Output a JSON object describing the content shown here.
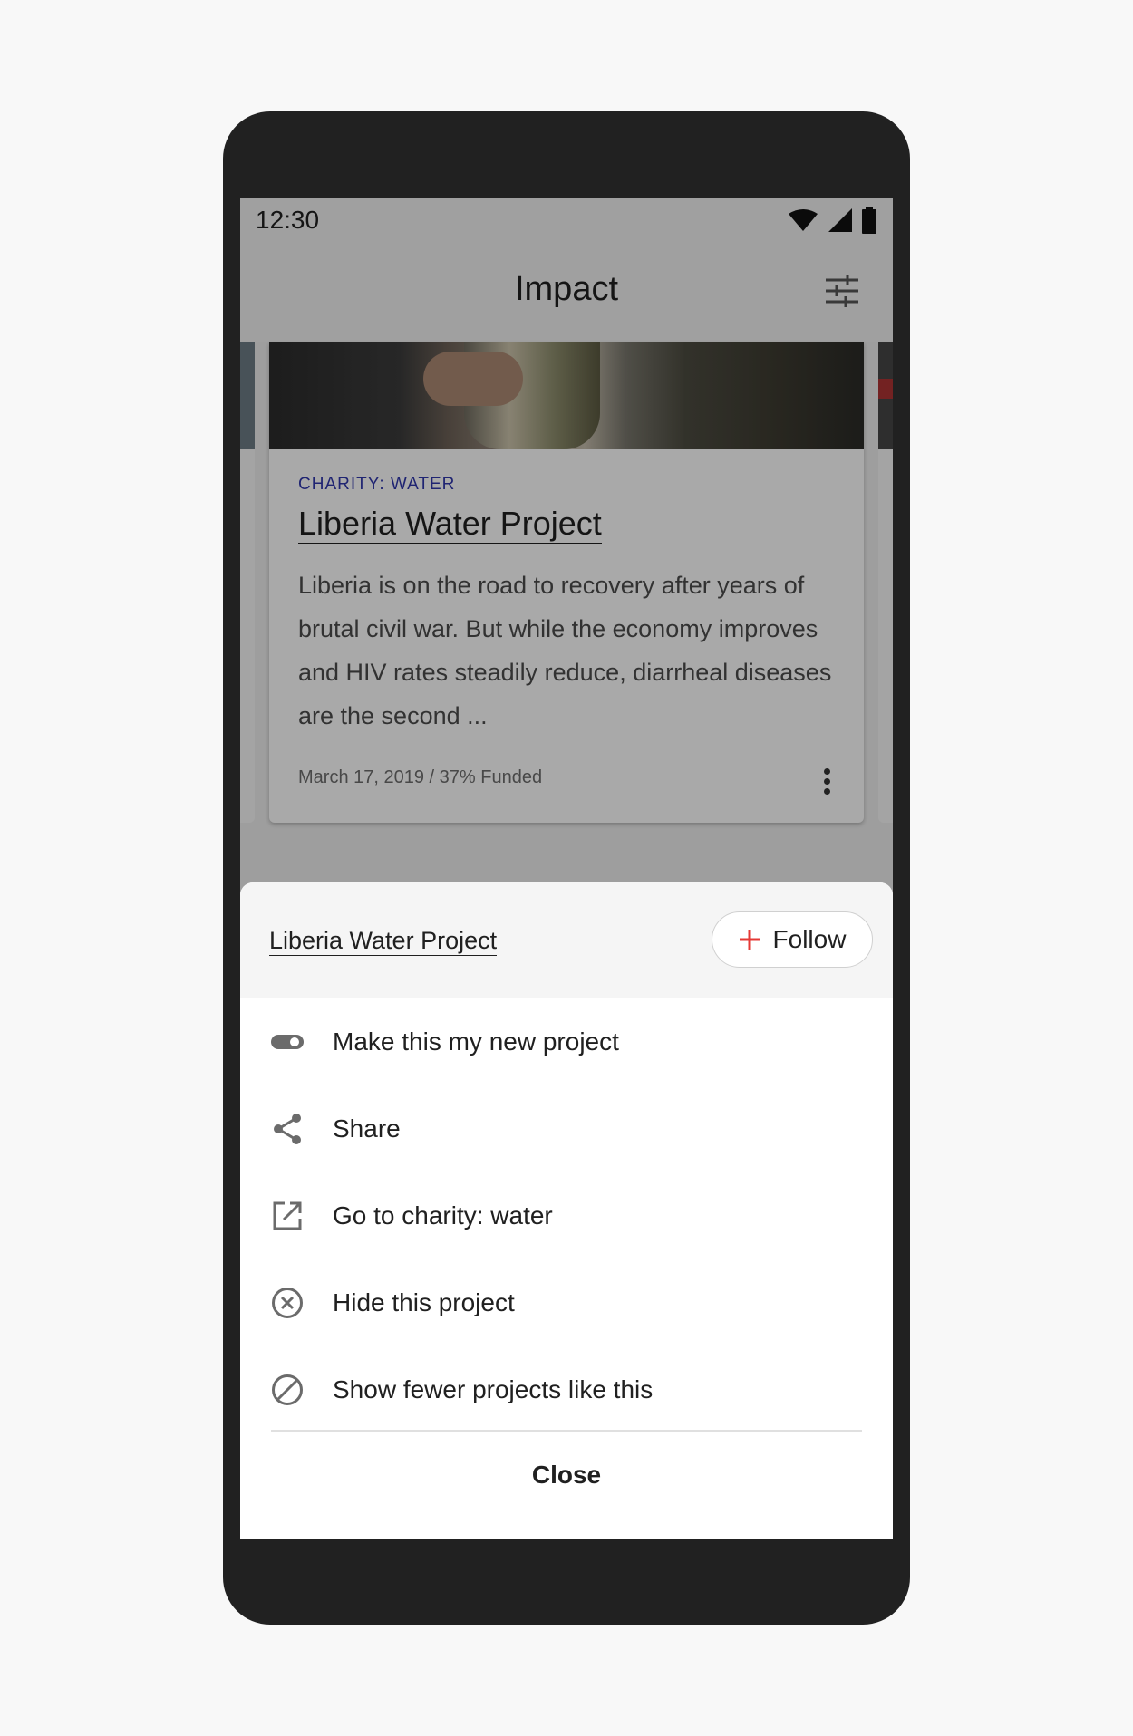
{
  "status_bar": {
    "time": "12:30"
  },
  "app_bar": {
    "title": "Impact",
    "filter_icon": "tune-icon"
  },
  "card": {
    "eyebrow": "CHARITY: WATER",
    "title": "Liberia Water Project",
    "description": "Liberia is on the road to recovery after years of brutal civil war. But while the economy improves and HIV rates steadily reduce, diarrheal diseases are the second ...",
    "meta": "March 17, 2019 / 37% Funded"
  },
  "sheet": {
    "title": "Liberia Water Project",
    "follow_label": "Follow",
    "items": [
      {
        "label": "Make this my new project",
        "icon": "toggle-icon"
      },
      {
        "label": "Share",
        "icon": "share-icon"
      },
      {
        "label": "Go to charity: water",
        "icon": "open-external-icon"
      },
      {
        "label": "Hide this project",
        "icon": "cancel-circle-icon"
      },
      {
        "label": "Show fewer projects like this",
        "icon": "block-icon"
      }
    ],
    "close_label": "Close"
  },
  "colors": {
    "accent": "#e53935",
    "eyebrow": "#2f35a8",
    "text": "#202020",
    "icon": "#6b6b6b"
  }
}
